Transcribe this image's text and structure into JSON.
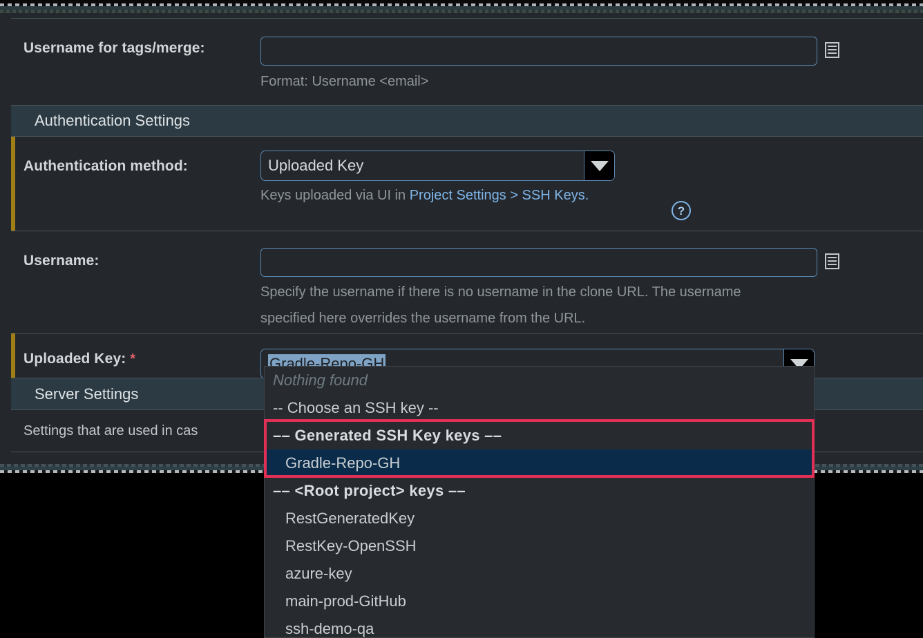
{
  "form": {
    "username_tags": {
      "label": "Username for tags/merge:",
      "value": "",
      "hint": "Format: Username <email>",
      "edit_icon": "document-lines-icon"
    },
    "auth_section": {
      "title": "Authentication Settings"
    },
    "auth_method": {
      "label": "Authentication method:",
      "value": "Uploaded Key",
      "hint_prefix": "Keys uploaded via UI in ",
      "hint_link": "Project Settings > SSH Keys.",
      "help_icon": "question-mark-circle-icon",
      "dropdown_icon": "caret-down-icon"
    },
    "username": {
      "label": "Username:",
      "value": "",
      "hint_line1": "Specify the username if there is no username in the clone URL. The username",
      "hint_line2": "specified here overrides the username from the URL.",
      "edit_icon": "document-lines-icon"
    },
    "uploaded_key": {
      "label": "Uploaded Key:",
      "required_marker": "*",
      "value": "Gradle-Repo-GH",
      "dropdown_icon": "caret-down-icon"
    },
    "server_section": {
      "title": "Server Settings"
    },
    "server_description": "Settings that are used in cas"
  },
  "dropdown": {
    "empty_text": "Nothing found",
    "items": [
      {
        "text": "-- Choose an SSH key --",
        "type": "placeholder"
      },
      {
        "text": "–– Generated SSH Key keys ––",
        "type": "group"
      },
      {
        "text": "Gradle-Repo-GH",
        "type": "option",
        "highlighted": true
      },
      {
        "text": "–– <Root project> keys ––",
        "type": "group"
      },
      {
        "text": "RestGeneratedKey",
        "type": "option"
      },
      {
        "text": "RestKey-OpenSSH",
        "type": "option"
      },
      {
        "text": "azure-key",
        "type": "option"
      },
      {
        "text": "main-prod-GitHub",
        "type": "option"
      },
      {
        "text": "ssh-demo-qa",
        "type": "option"
      }
    ]
  },
  "colors": {
    "page_background": "#24282d",
    "section_header": "#2b3a43",
    "field_border": "#5c87ae",
    "link": "#7fb5e8",
    "required": "#e4606a",
    "modified_marker": "#a07f16",
    "annotation": "#e03055",
    "dropdown_highlight": "#0a2c4a",
    "selection": "#7fa3c4"
  }
}
